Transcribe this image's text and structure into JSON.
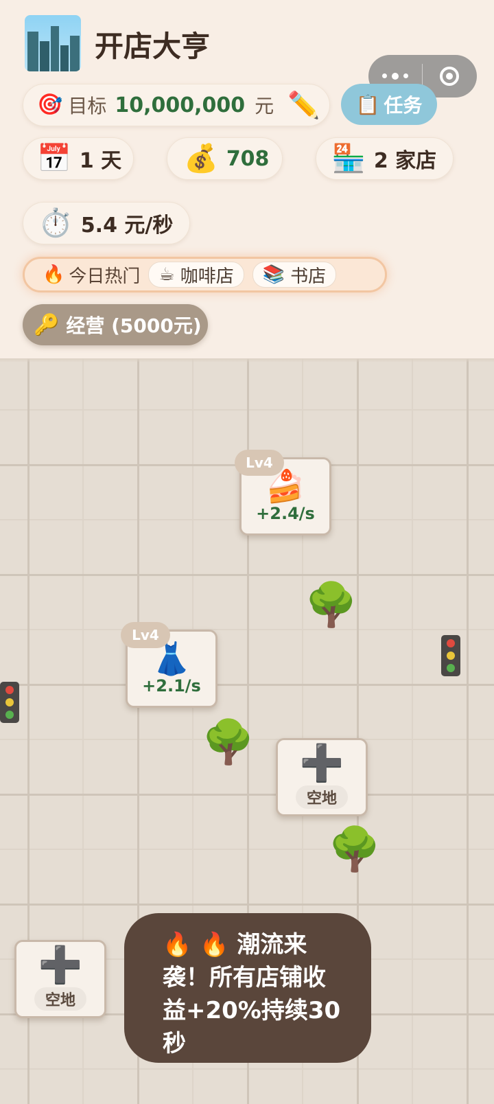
{
  "header": {
    "app_title": "开店大亨",
    "goal": {
      "icon": "🎯",
      "label": "目标",
      "amount": "10,000,000",
      "unit": "元",
      "edit_icon": "✏️"
    },
    "task_button": {
      "icon": "📋",
      "label": "任务"
    },
    "stats": {
      "day": {
        "icon": "📅",
        "value": "1 天"
      },
      "cash": {
        "icon": "💰",
        "value": "708"
      },
      "shops": {
        "icon": "🏪",
        "value": "2 家店"
      },
      "rate": {
        "icon": "⏱️",
        "value": "5.4 元/秒"
      }
    },
    "hot_today": {
      "icon": "🔥",
      "label": "今日热门",
      "items": [
        {
          "icon": "☕",
          "label": "咖啡店"
        },
        {
          "icon": "📚",
          "label": "书店"
        }
      ]
    },
    "operate_button": {
      "icon": "🔑",
      "label": "经营 (5000元)"
    }
  },
  "map": {
    "shops": [
      {
        "name": "cake",
        "level": "Lv4",
        "icon": "🍰",
        "income": "+2.4/s"
      },
      {
        "name": "dress",
        "level": "Lv4",
        "icon": "👗",
        "income": "+2.1/s"
      }
    ],
    "empty_lots": [
      {
        "icon": "➕",
        "label": "空地"
      },
      {
        "icon": "➕",
        "label": "空地"
      }
    ],
    "tree_icon": "🌳"
  },
  "toast": {
    "text": "🔥 🔥 潮流来袭！所有店铺收益+20%持续30秒"
  },
  "colors": {
    "background": "#f6ede4",
    "accent_green": "#2f6e3c",
    "task_button": "#8fc7da",
    "operate_button": "#a99988",
    "toast_bg": "#5a463b"
  }
}
